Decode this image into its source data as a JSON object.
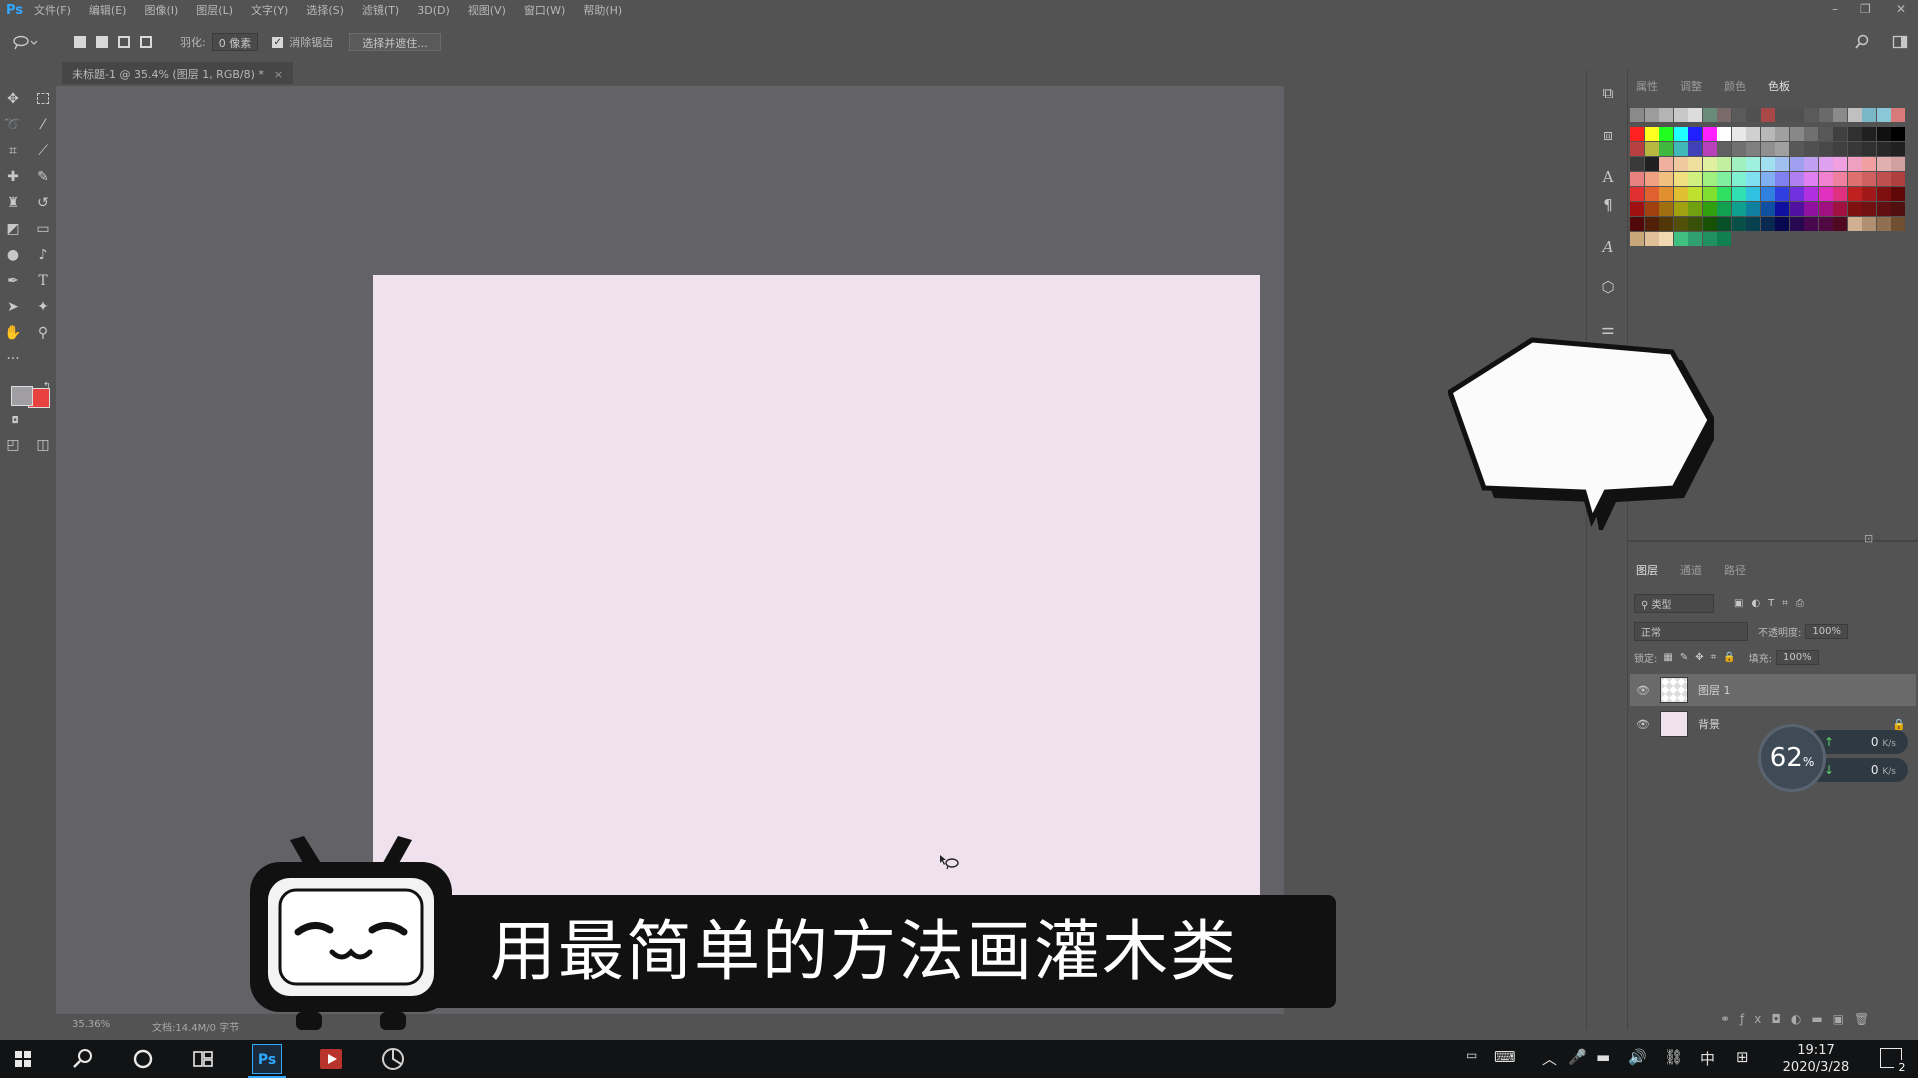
{
  "app": {
    "logo": "Ps",
    "menu": [
      "文件(F)",
      "编辑(E)",
      "图像(I)",
      "图层(L)",
      "文字(Y)",
      "选择(S)",
      "滤镜(T)",
      "3D(D)",
      "视图(V)",
      "窗口(W)",
      "帮助(H)"
    ],
    "window_controls": [
      "–",
      "❐",
      "✕"
    ]
  },
  "options_bar": {
    "feather_label": "羽化:",
    "feather_value": "0 像素",
    "antialias_label": "消除锯齿",
    "antialias_checked": true,
    "select_mask_button": "选择并遮住..."
  },
  "document": {
    "tab_title": "未标题-1 @ 35.4% (图层 1, RGB/8) *",
    "close_glyph": "×",
    "canvas_color": "#efe2ee",
    "zoom": "35.36%",
    "doc_size": "文档:14.4M/0 字节"
  },
  "tools": {
    "icons": [
      "move-icon",
      "marquee-icon",
      "lasso-icon",
      "magic-wand-icon",
      "crop-icon",
      "eyedropper-icon",
      "healing-icon",
      "brush-icon",
      "stamp-icon",
      "history-brush-icon",
      "eraser-icon",
      "gradient-icon",
      "blur-icon",
      "dodge-icon",
      "pen-icon",
      "type-icon",
      "path-select-icon",
      "shape-icon",
      "hand-icon",
      "zoom-icon",
      "more-tools-icon"
    ],
    "foreground_color": "#a09ea2",
    "background_color": "#e8413f"
  },
  "right_panel": {
    "top_tabs": [
      "属性",
      "调整",
      "颜色",
      "色板"
    ],
    "active_top_tab": "色板",
    "layer_tabs": [
      "图层",
      "通道",
      "路径"
    ],
    "active_layer_tab": "图层",
    "filter_label": "类型",
    "blend_mode": "正常",
    "opacity_label": "不透明度:",
    "opacity_value": "100%",
    "lock_label": "锁定:",
    "fill_label": "填充:",
    "fill_value": "100%",
    "layers": [
      {
        "name": "图层 1",
        "selected": true,
        "visible": true
      },
      {
        "name": "背景",
        "selected": false,
        "visible": true,
        "locked": true
      }
    ]
  },
  "net_widget": {
    "cpu": "62",
    "cpu_unit": "%",
    "up": "0",
    "down": "0",
    "rate_unit": "K/s"
  },
  "caption": {
    "text": "用最简单的方法画灌木类"
  },
  "taskbar": {
    "time": "19:17",
    "date": "2020/3/28",
    "ime": "中",
    "notif_count": "2"
  }
}
